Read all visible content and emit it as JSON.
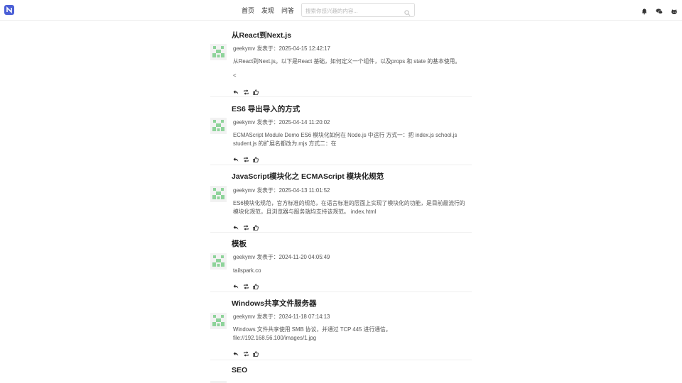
{
  "header": {
    "nav": [
      "首页",
      "发现",
      "问答"
    ],
    "search_placeholder": "搜索你感兴趣的内容...",
    "icons": [
      "logo-icon",
      "search-icon",
      "bell-icon",
      "chat-icon",
      "github-icon"
    ]
  },
  "posts": [
    {
      "title": "从React到Next.js",
      "author": "geekymv",
      "posted_label": "发表于：",
      "date": "2025-04-15 12:42:17",
      "excerpt": "从React到Next.js。以下是React 基础，如何定义一个组件，以及props 和 state 的基本使用。",
      "excerpt2": "<"
    },
    {
      "title": "ES6 导出导入的方式",
      "author": "geekymv",
      "posted_label": "发表于：",
      "date": "2025-04-14 11:20:02",
      "excerpt": "ECMAScript Module Demo ES6 模块化如何在 Node.js 中运行 方式一：把 index.js school.js student.js 的扩展名都改为.mjs 方式二：在",
      "excerpt2": ""
    },
    {
      "title": "JavaScript模块化之 ECMAScript 模块化规范",
      "author": "geekymv",
      "posted_label": "发表于：",
      "date": "2025-04-13 11:01:52",
      "excerpt": "ES6模块化规范，官方标准的规范，在语言标准的层面上实现了模块化的功能，是目前最流行的模块化规范，且浏览器与服务端均支持该规范。 index.html",
      "excerpt2": ""
    },
    {
      "title": "模板",
      "author": "geekymv",
      "posted_label": "发表于：",
      "date": "2024-11-20 04:05:49",
      "excerpt": "tailspark.co",
      "excerpt2": ""
    },
    {
      "title": "Windows共享文件服务器",
      "author": "geekymv",
      "posted_label": "发表于：",
      "date": "2024-11-18 07:14:13",
      "excerpt": "Windows 文件共享使用 SMB 协议，并通过 TCP 445 进行通信。",
      "excerpt2": "file://192.168.56.100/images/1.jpg"
    },
    {
      "title": "SEO",
      "author": "",
      "posted_label": "",
      "date": "",
      "excerpt": "",
      "excerpt2": ""
    }
  ],
  "colors": {
    "brand": "#4b5fd6",
    "avatar": "#8ed39a"
  }
}
